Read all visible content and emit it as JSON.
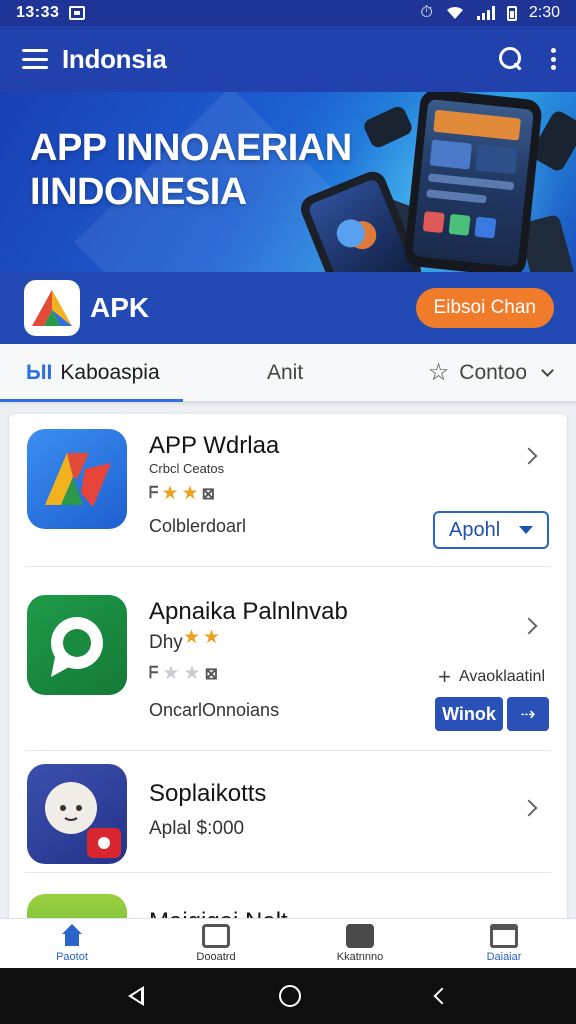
{
  "status_bar": {
    "time": "13:33",
    "right_text": "2:30"
  },
  "app_bar": {
    "title": "Indonsia",
    "icons": [
      "menu-icon",
      "search-icon",
      "more-vert-icon"
    ]
  },
  "banner": {
    "line1": "APP INNOAERIAN",
    "line2": "IINDONESIA"
  },
  "apk_strip": {
    "label": "APK",
    "button": "Eibsoi Chan",
    "button_color": "#f07c2b"
  },
  "tabs": [
    {
      "badge": "ЫI",
      "label": "Kaboaspia"
    },
    {
      "label": "Anit"
    },
    {
      "label": "Contoo"
    }
  ],
  "apps": [
    {
      "name": "APP Wdrlaa",
      "subtitle": "Crbcl Ceatos",
      "info": "Colblerdoarl",
      "rating": 3,
      "action": "Apohl"
    },
    {
      "name": "Apnaika Palnlnvab",
      "subtitle": "Dhy",
      "rating": 1,
      "info": "OncarlOnnoians",
      "add_text": "Avaoklaatinl",
      "action": "Winok"
    },
    {
      "name": "Soplaikotts",
      "subtitle": "Aplal $:000"
    },
    {
      "name": "Maigigai Nalt"
    }
  ],
  "bottom_nav": [
    {
      "label": "Paotot",
      "icon": "home-icon"
    },
    {
      "label": "Dooatrd",
      "icon": "updates-icon"
    },
    {
      "label": "Kkatnnno",
      "icon": "grid-icon"
    },
    {
      "label": "Daiaiar",
      "icon": "tabs-icon"
    }
  ],
  "colors": {
    "primary": "#2142ad",
    "accent": "#f07c2b",
    "star": "#e9a321"
  }
}
